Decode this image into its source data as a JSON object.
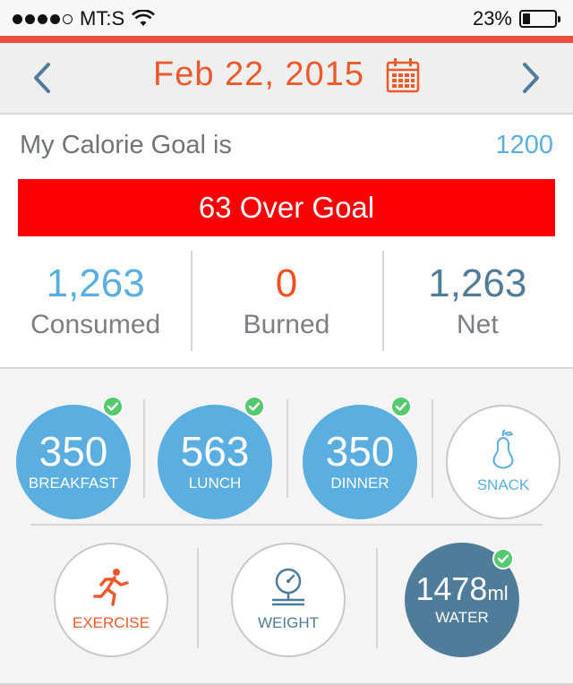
{
  "status_bar": {
    "carrier": "MT:S",
    "battery_percent": "23%",
    "battery_level": 0.23,
    "signal_bars_filled": 4,
    "signal_bars_total": 5
  },
  "header": {
    "date": "Feb 22, 2015",
    "prev_icon": "chevron-left-icon",
    "next_icon": "chevron-right-icon",
    "calendar_icon": "calendar-icon"
  },
  "goal": {
    "label": "My Calorie Goal is",
    "value": "1200",
    "status": "63 Over Goal"
  },
  "stats": [
    {
      "value": "1,263",
      "label": "Consumed"
    },
    {
      "value": "0",
      "label": "Burned"
    },
    {
      "value": "1,263",
      "label": "Net"
    }
  ],
  "meals": [
    {
      "value": "350",
      "label": "BREAKFAST",
      "checked": true
    },
    {
      "value": "563",
      "label": "LUNCH",
      "checked": true
    },
    {
      "value": "350",
      "label": "DINNER",
      "checked": true
    },
    {
      "label": "SNACK",
      "icon": "pear-icon",
      "checked": false
    }
  ],
  "activities": [
    {
      "label": "EXERCISE",
      "icon": "running-person-icon"
    },
    {
      "label": "WEIGHT",
      "icon": "scale-icon"
    },
    {
      "value": "1478",
      "unit": "ml",
      "label": "WATER",
      "checked": true
    }
  ],
  "colors": {
    "accent_orange": "#ec5a2b",
    "accent_strip": "#e84f3f",
    "blue": "#5aaee0",
    "slate": "#4f7d99",
    "alert_red": "#fb0002",
    "check_green": "#55c96e"
  }
}
